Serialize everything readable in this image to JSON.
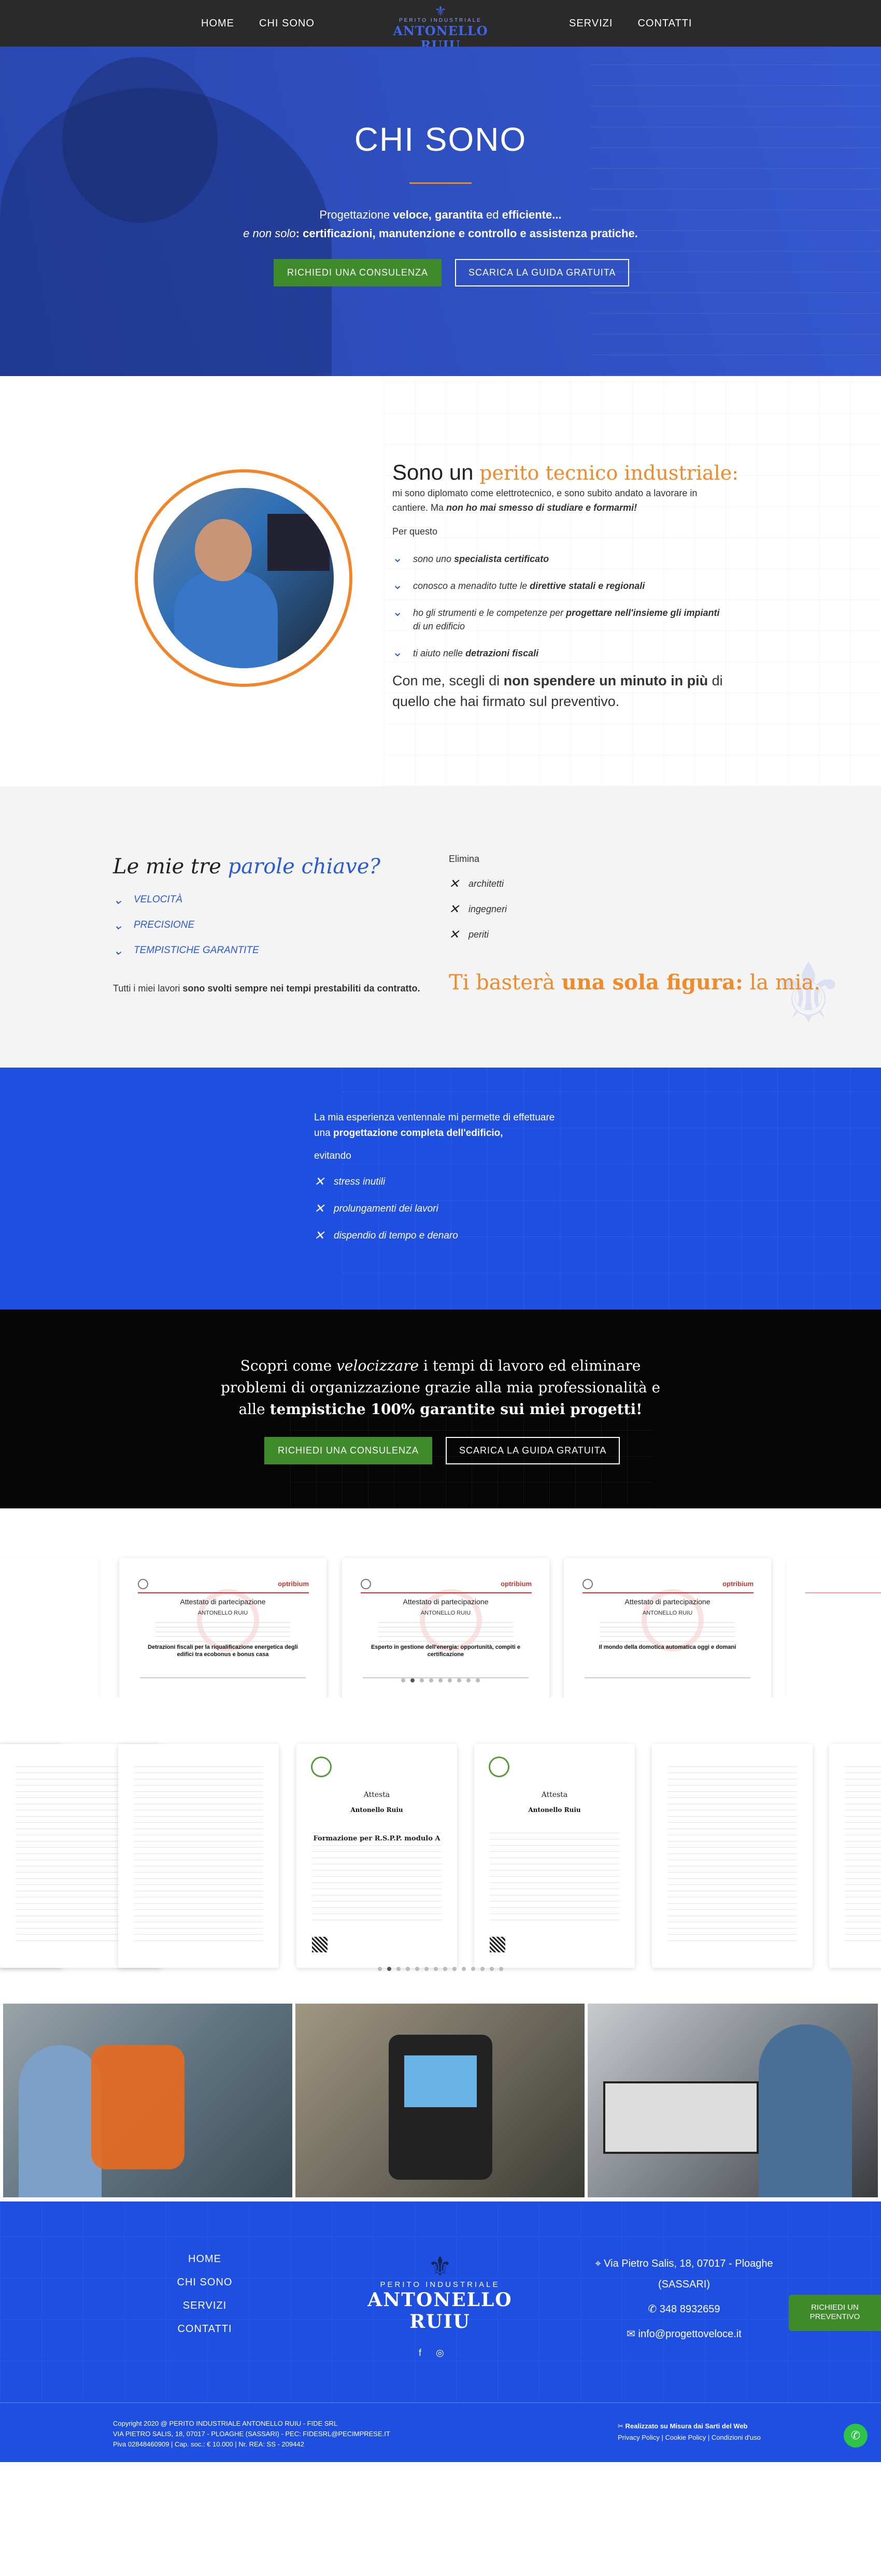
{
  "nav": {
    "left": [
      "HOME",
      "CHI SONO"
    ],
    "right": [
      "SERVIZI",
      "CONTATTI"
    ],
    "logo_small": "PERITO INDUSTRIALE",
    "logo_big": "ANTONELLO RUIU"
  },
  "hero": {
    "title": "CHI SONO",
    "line1_a": "Progettazione ",
    "line1_b": "veloce, garantita",
    "line1_c": " ed ",
    "line1_d": "efficiente...",
    "line2_a": "e non solo",
    "line2_b": ": certificazioni, manutenzione e controllo e assistenza pratiche.",
    "btn_primary": "RICHIEDI UNA CONSULENZA",
    "btn_secondary": "SCARICA LA GUIDA GRATUITA"
  },
  "about": {
    "heading_a": "Sono un ",
    "heading_b": "perito tecnico industriale:",
    "intro_a": "mi sono diplomato come elettrotecnico, e sono subito andato a lavorare in cantiere. Ma ",
    "intro_b": "non ho mai smesso di studiare e formarmi!",
    "perquesto": "Per questo",
    "items": [
      {
        "a": "sono uno ",
        "b": "specialista certificato",
        "c": ""
      },
      {
        "a": "conosco a menadito tutte le ",
        "b": "direttive statali e regionali",
        "c": ""
      },
      {
        "a": "ho gli strumenti e le competenze per ",
        "b": "progettare nell'insieme gli impianti",
        "c": " di un edificio"
      },
      {
        "a": "ti aiuto nelle ",
        "b": "detrazioni fiscali",
        "c": ""
      }
    ],
    "closing_a": "Con me, scegli di ",
    "closing_b": "non spendere un minuto in più",
    "closing_c": " di quello che hai firmato sul preventivo."
  },
  "keywords": {
    "heading_a": "Le mie tre ",
    "heading_b": "parole chiave?",
    "items": [
      "VELOCITÀ",
      "PRECISIONE",
      "TEMPISTICHE GARANTITE"
    ],
    "footline_a": "Tutti i miei lavori ",
    "footline_b": "sono svolti sempre nei tempi prestabiliti da contratto.",
    "elimina": "Elimina",
    "elim_items": [
      "architetti",
      "ingegneri",
      "periti"
    ],
    "tagline_a": "Ti basterà ",
    "tagline_b": "una sola figura:",
    "tagline_c": " la mia."
  },
  "band": {
    "line1": "La mia esperienza ventennale mi permette di effettuare",
    "line2_a": "una ",
    "line2_b": "progettazione completa dell'edificio,",
    "evitando": "evitando",
    "items": [
      "stress inutili",
      "prolungamenti dei lavori",
      "dispendio di tempo e denaro"
    ]
  },
  "cta": {
    "l1_a": "Scopri come ",
    "l1_b": "velocizzare",
    "l1_c": " i tempi di lavoro ed eliminare",
    "l2": "problemi di organizzazione grazie alla mia professionalità e",
    "l3_a": "alle ",
    "l3_b": "tempistiche 100% garantite sui miei progetti!",
    "btn_primary": "RICHIEDI UNA CONSULENZA",
    "btn_secondary": "SCARICA LA GUIDA GRATUITA"
  },
  "certs1": {
    "cards": [
      {
        "brand": "optribium",
        "title": "Attestato di partecipazione",
        "name": "ANTONELLO RUIU",
        "course": "Detrazioni fiscali per la riqualificazione energetica degli edifici tra ecobonus e bonus casa"
      },
      {
        "brand": "optribium",
        "title": "Attestato di partecipazione",
        "name": "ANTONELLO RUIU",
        "course": "Esperto in gestione dell'energia: opportunità, compiti e certificazione"
      },
      {
        "brand": "optribium",
        "title": "Attestato di partecipazione",
        "name": "ANTONELLO RUIU",
        "course": "Il mondo della domotica automatica oggi e domani"
      }
    ],
    "active_dot": 1,
    "dot_count": 9
  },
  "certs2": {
    "cards": [
      {
        "title": "Attesta",
        "name": "Antonello Ruiu",
        "course": "Formazione per R.S.P.P. modulo A"
      },
      {
        "title": "Attesta",
        "name": "Antonello Ruiu",
        "course": ""
      }
    ],
    "active_dot": 1,
    "dot_count": 14
  },
  "footer": {
    "menu": [
      "HOME",
      "CHI SONO",
      "SERVIZI",
      "CONTATTI"
    ],
    "logo_small": "PERITO INDUSTRIALE",
    "logo_big": "ANTONELLO RUIU",
    "address": "Via Pietro Salis, 18, 07017 - Ploaghe (SASSARI)",
    "phone": "348 8932659",
    "email": "info@progettoveloce.it",
    "side_btn": "RICHIEDI UN PREVENTIVO",
    "copy_l1": "Copyright 2020 @ PERITO INDUSTRIALE ANTONELLO RUIU - FIDE SRL",
    "copy_l2": "VIA PIETRO SALIS, 18, 07017 - PLOAGHE (SASSARI) - PEC: FIDESRL@PECIMPRESE.IT",
    "copy_l3": "Piva 02848460909 | Cap. soc.: € 10.000 | Nr. REA: SS - 209442",
    "copy_r1": "Realizzato su Misura dai Sarti del Web",
    "copy_r2": "Privacy Policy | Cookie Policy | Condizioni d'uso"
  },
  "colors": {
    "accent_blue": "#1f4fe0",
    "accent_orange": "#f08a2a",
    "cta_green": "#3f8a2a"
  }
}
